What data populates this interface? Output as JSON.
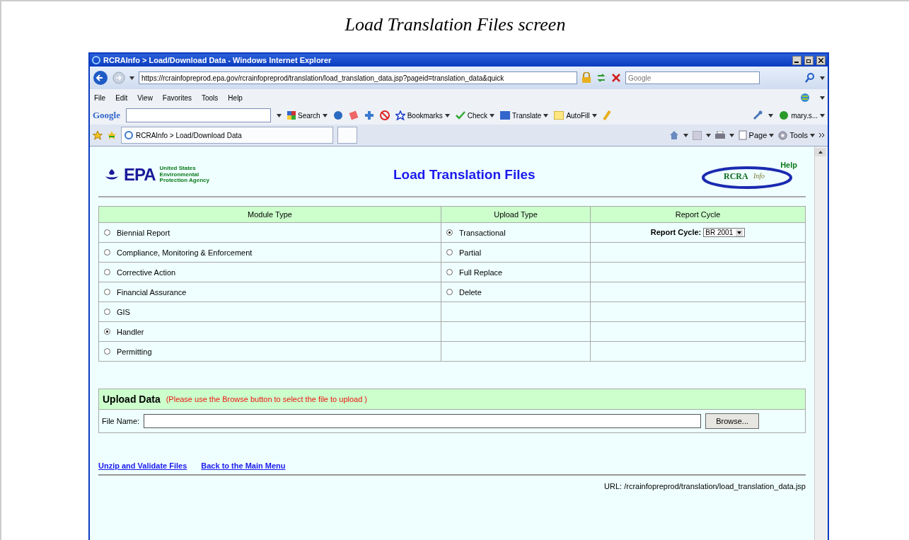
{
  "caption": "Load Translation Files screen",
  "window": {
    "title": "RCRAInfo > Load/Download Data - Windows Internet Explorer"
  },
  "address_bar": {
    "value": "https://rcrainfopreprod.epa.gov/rcrainfopreprod/translation/load_translation_data.jsp?pageid=translation_data&quick"
  },
  "search_box": {
    "placeholder": "Google"
  },
  "menu": [
    "File",
    "Edit",
    "View",
    "Favorites",
    "Tools",
    "Help"
  ],
  "google_toolbar": {
    "logo": "Google",
    "items": [
      "Search",
      "Bookmarks",
      "Check",
      "Translate",
      "AutoFill",
      "mary.s..."
    ]
  },
  "tab": {
    "label": "RCRAInfo > Load/Download Data"
  },
  "command_bar": [
    "Page",
    "Tools"
  ],
  "page": {
    "logo": "EPA",
    "agency": "United States Environmental Protection Agency",
    "heading": "Load Translation Files",
    "rcra_logo": "RCRA",
    "rcra_script": "Info",
    "help": "Help",
    "columns": [
      "Module Type",
      "Upload Type",
      "Report Cycle"
    ],
    "module_types": [
      {
        "label": "Biennial Report",
        "selected": false
      },
      {
        "label": "Compliance, Monitoring & Enforcement",
        "selected": false
      },
      {
        "label": "Corrective Action",
        "selected": false
      },
      {
        "label": "Financial Assurance",
        "selected": false
      },
      {
        "label": "GIS",
        "selected": false
      },
      {
        "label": "Handler",
        "selected": true
      },
      {
        "label": "Permitting",
        "selected": false
      }
    ],
    "upload_types": [
      {
        "label": "Transactional",
        "selected": true
      },
      {
        "label": "Partial",
        "selected": false
      },
      {
        "label": "Full Replace",
        "selected": false
      },
      {
        "label": "Delete",
        "selected": false
      }
    ],
    "report_cycle": {
      "label": "Report Cycle:",
      "value": "BR 2001"
    },
    "upload": {
      "title": "Upload Data",
      "note": "(Please use the Browse button to select the file to upload )",
      "field_label": "File Name:",
      "button": "Browse..."
    },
    "links": [
      "Unzip and Validate Files",
      "Back to the Main Menu"
    ],
    "url_text": "URL: /rcrainfopreprod/translation/load_translation_data.jsp"
  }
}
